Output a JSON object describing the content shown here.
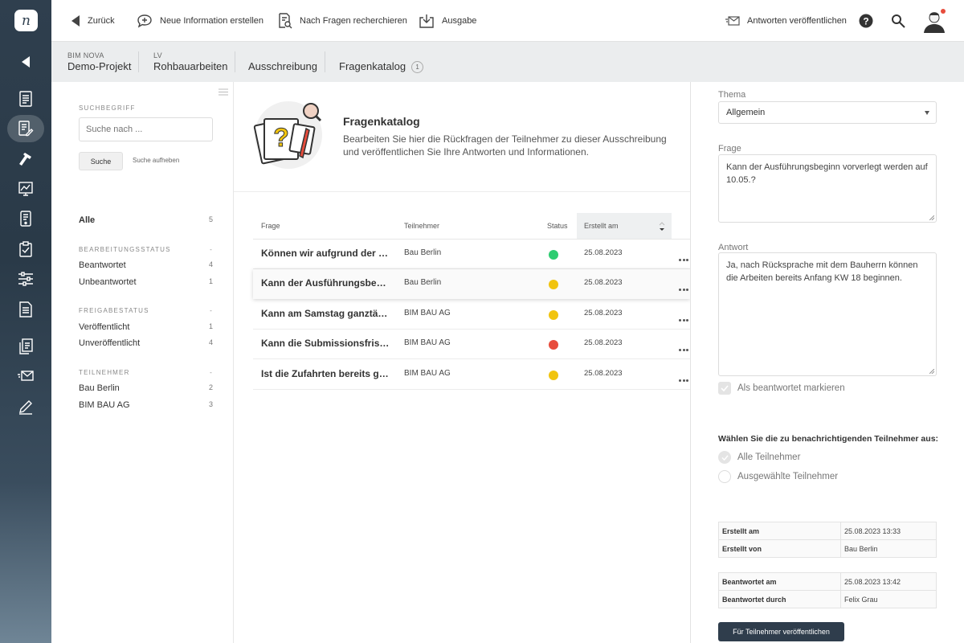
{
  "colors": {
    "rail": "#2f3f4e",
    "status_green": "#2ecc71",
    "status_yellow": "#f1c40f",
    "status_red": "#e74c3c",
    "primary_button": "#2f3d4c"
  },
  "app": {
    "logo_letter": "n"
  },
  "rail_icons": [
    "collapse-icon",
    "document-icon",
    "edit-document-icon",
    "hammer-icon",
    "chart-icon",
    "phone-document-icon",
    "clipboard-check-icon",
    "sliders-icon",
    "list-document-icon",
    "copy-document-icon",
    "mail-icon",
    "pen-icon"
  ],
  "toolbar": {
    "back": "Zurück",
    "new_info": "Neue Information erstellen",
    "research": "Nach Fragen recherchieren",
    "output": "Ausgabe",
    "publish_answers": "Antworten veröffentlichen"
  },
  "breadcrumb": {
    "project_label": "BIM NOVA",
    "project": "Demo-Projekt",
    "lv_label": "LV",
    "lv": "Rohbauarbeiten",
    "tender": "Ausschreibung",
    "catalog": "Fragenkatalog",
    "catalog_count": "1"
  },
  "filters": {
    "search_label": "SUCHBEGRIFF",
    "search_placeholder": "Suche nach ...",
    "search_button": "Suche",
    "clear_link": "Suche aufheben",
    "all": {
      "label": "Alle",
      "count": "5"
    },
    "status_head": "BEARBEITUNGSSTATUS",
    "status_dash": "-",
    "status": [
      {
        "label": "Beantwortet",
        "count": "4"
      },
      {
        "label": "Unbeantwortet",
        "count": "1"
      }
    ],
    "release_head": "FREIGABESTATUS",
    "release_dash": "-",
    "release": [
      {
        "label": "Veröffentlicht",
        "count": "1"
      },
      {
        "label": "Unveröffentlicht",
        "count": "4"
      }
    ],
    "participants_head": "TEILNEHMER",
    "participants_dash": "-",
    "participants": [
      {
        "label": "Bau Berlin",
        "count": "2"
      },
      {
        "label": "BIM BAU AG",
        "count": "3"
      }
    ]
  },
  "intro": {
    "title": "Fragenkatalog",
    "text": "Bearbeiten Sie hier die Rückfragen der Teilnehmer zu dieser Ausschreibung und veröffentlichen Sie Ihre Antworten und Informationen."
  },
  "table": {
    "headers": {
      "question": "Frage",
      "participant": "Teilnehmer",
      "status": "Status",
      "created": "Erstellt am"
    },
    "rows": [
      {
        "question": "Können wir aufgrund der aktuellen Lage",
        "participant": "Bau Berlin",
        "status": "green",
        "date": "25.08.2023"
      },
      {
        "question": "Kann der Ausführungsbeginn vorverlegt werden",
        "participant": "Bau Berlin",
        "status": "yellow",
        "date": "25.08.2023"
      },
      {
        "question": "Kann am Samstag ganztägig gearbeitet werden",
        "participant": "BIM BAU AG",
        "status": "yellow",
        "date": "25.08.2023"
      },
      {
        "question": "Kann die Submissionsfrist verlängert werden",
        "participant": "BIM BAU AG",
        "status": "red",
        "date": "25.08.2023"
      },
      {
        "question": "Ist die Zufahrten bereits gesperrt",
        "participant": "BIM BAU AG",
        "status": "yellow",
        "date": "25.08.2023"
      }
    ]
  },
  "detail": {
    "topic_label": "Thema",
    "topic_value": "Allgemein",
    "question_label": "Frage",
    "question_text": "Kann der Ausführungsbeginn vorverlegt werden auf 10.05.?",
    "answer_label": "Antwort",
    "answer_text": "Ja, nach Rücksprache mit dem Bauherrn können die Arbeiten bereits Anfang KW 18 beginnen.",
    "mark_answered": "Als beantwortet markieren",
    "notify_title": "Wählen Sie die zu benachrichtigenden Teilnehmer aus:",
    "notify_all": "Alle Teilnehmer",
    "notify_selected": "Ausgewählte Teilnehmer",
    "created_at_label": "Erstellt am",
    "created_at": "25.08.2023 13:33",
    "created_by_label": "Erstellt von",
    "created_by": "Bau Berlin",
    "answered_at_label": "Beantwortet am",
    "answered_at": "25.08.2023 13:42",
    "answered_by_label": "Beantwortet durch",
    "answered_by": "Felix Grau",
    "publish_button": "Für Teilnehmer veröffentlichen"
  }
}
